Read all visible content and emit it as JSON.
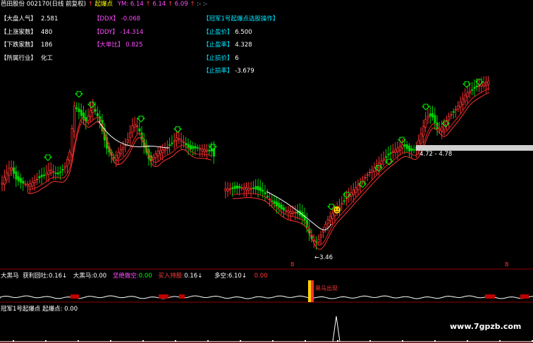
{
  "header": {
    "stock_title": "芭田股份 002170(日线 前复权)",
    "arrow": "↑",
    "indicator_name": "起爆点",
    "ym_label": "YM:",
    "ym_values": [
      "6.14",
      "6.14",
      "6.09"
    ],
    "tail": ":- :-"
  },
  "info_left": [
    {
      "label": "【大盘人气】",
      "value": "2.581"
    },
    {
      "label": "【上涨家数】",
      "value": "480"
    },
    {
      "label": "【下跌家数】",
      "value": "186"
    },
    {
      "label": "【所属行业】",
      "value": "化工"
    }
  ],
  "info_mid": [
    {
      "label": "【DDX】",
      "value": "-0.068"
    },
    {
      "label": "【DDY】",
      "value": "-14.314"
    },
    {
      "label": "【大单比】",
      "value": "0.825"
    }
  ],
  "info_right": {
    "title": "【冠军1号起爆点选股操作】",
    "rows": [
      {
        "label": "【止盈价】",
        "value": "6.500"
      },
      {
        "label": "【止盈率】",
        "value": "4.328"
      },
      {
        "label": "【止损价】",
        "value": "6"
      },
      {
        "label": "【止损率】",
        "value": "-3.679"
      }
    ]
  },
  "price_annotations": {
    "range_label": "4.72 - 4.78",
    "low_label": "←3.46"
  },
  "panel2": {
    "items": [
      {
        "label": "大黑马",
        "value": ""
      },
      {
        "label": "获利回吐:",
        "value": "0.16↓"
      },
      {
        "label": "大黑马:",
        "value": "0.00"
      },
      {
        "label": "坚绝做空:",
        "value": "0.00"
      },
      {
        "label": "买入持股:",
        "value": "0.16↓"
      },
      {
        "label": "多空:",
        "value": "6.10↓"
      },
      {
        "label": "",
        "value": "0.00"
      }
    ],
    "highlight_label": "黑马出现"
  },
  "panel3": {
    "label": "冠军1号起爆点 起爆点:",
    "value": "0.00"
  },
  "watermark": "www.7gpzb.com",
  "colors": {
    "up": "#ff3232",
    "down": "#00d200",
    "background": "#000000",
    "divider": "#8b0000"
  },
  "chart_data": {
    "type": "candlestick",
    "low_marked": 3.46,
    "range_marked": [
      4.72,
      4.78
    ]
  }
}
